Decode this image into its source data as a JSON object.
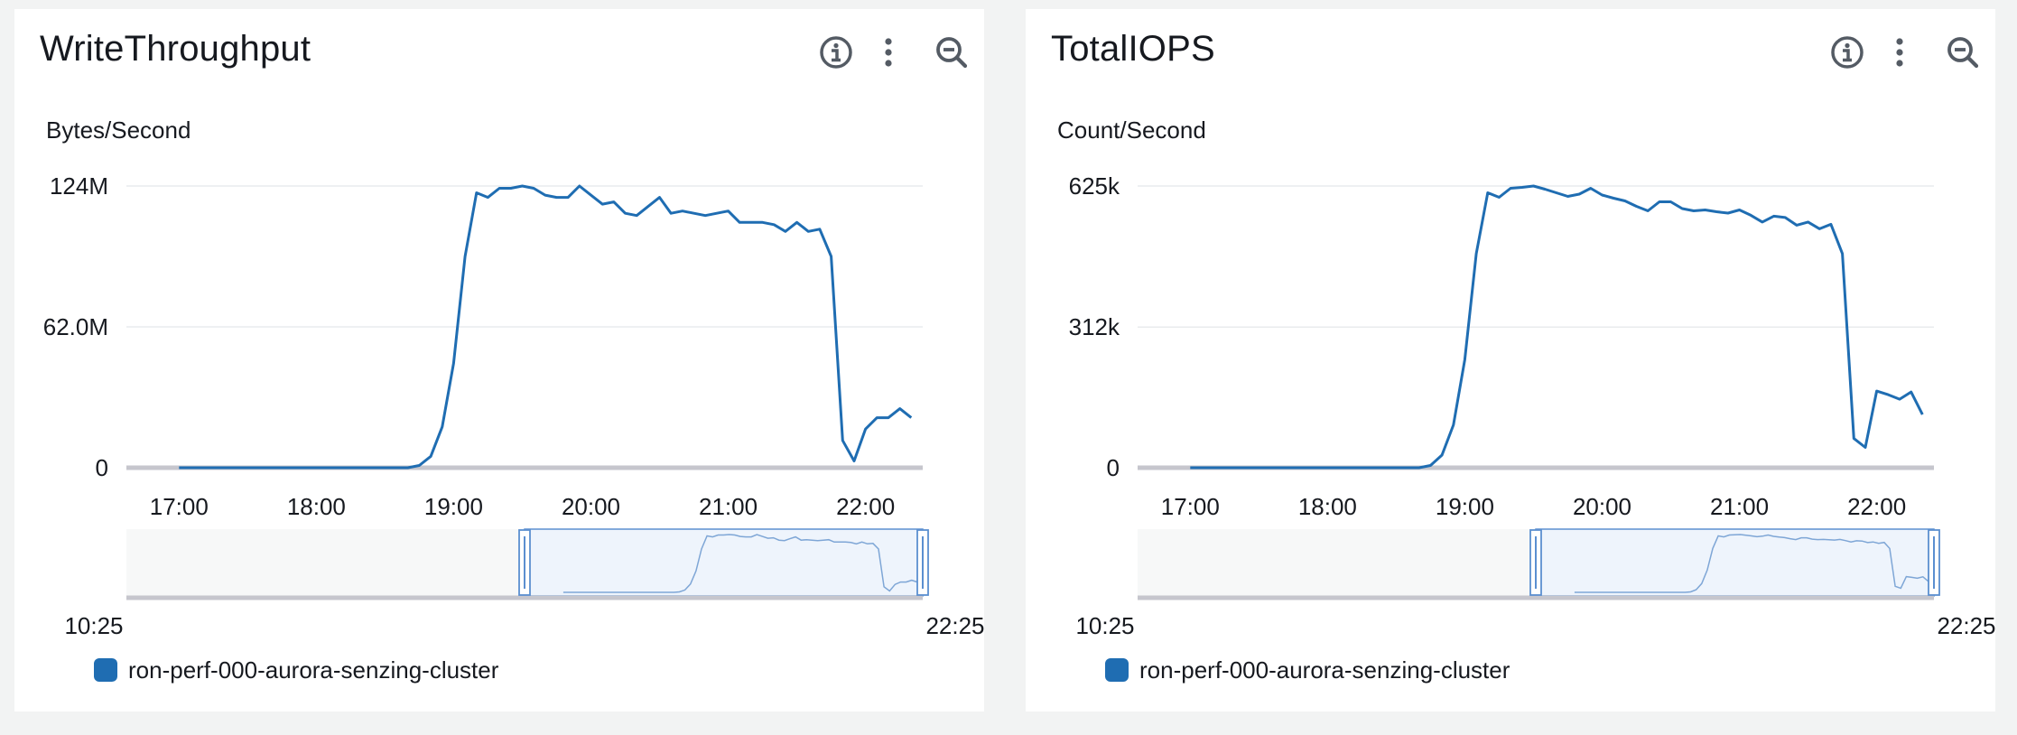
{
  "colors": {
    "page_background": "#f2f3f3",
    "panel_background": "#ffffff",
    "series": "#1f6db2",
    "grid": "#e9ebed",
    "baseline": "#c6c6cd",
    "navigator_fill": "#f7f8f8",
    "navigator_selection": "#eef4fc",
    "navigator_border": "#5b8fd0"
  },
  "icons": {
    "info": "info-circle-icon",
    "menu": "vertical-ellipsis-icon",
    "zoom": "zoom-out-icon"
  },
  "chart_data": [
    {
      "type": "line",
      "title": "WriteThroughput",
      "ylabel": "Bytes/Second",
      "ylim": [
        0,
        124000000
      ],
      "yticks": [
        0,
        62000000,
        124000000
      ],
      "ytick_labels": [
        "0",
        "62.0M",
        "124M"
      ],
      "xlim": [
        "16:37",
        "22:25"
      ],
      "xtick_labels": [
        "17:00",
        "18:00",
        "19:00",
        "20:00",
        "21:00",
        "22:00"
      ],
      "grid": true,
      "legend_position": "bottom-left",
      "navigator": {
        "start_label": "10:25",
        "end_label": "22:25",
        "selection": [
          "16:25",
          "22:25"
        ]
      },
      "series": [
        {
          "name": "ron-perf-000-aurora-senzing-cluster",
          "color": "#1f6db2",
          "x": [
            "17:00",
            "17:05",
            "17:10",
            "17:15",
            "17:20",
            "17:25",
            "17:30",
            "17:35",
            "17:40",
            "17:45",
            "17:50",
            "17:55",
            "18:00",
            "18:05",
            "18:10",
            "18:15",
            "18:20",
            "18:25",
            "18:30",
            "18:35",
            "18:40",
            "18:45",
            "18:50",
            "18:55",
            "19:00",
            "19:05",
            "19:10",
            "19:15",
            "19:20",
            "19:25",
            "19:30",
            "19:35",
            "19:40",
            "19:45",
            "19:50",
            "19:55",
            "20:00",
            "20:05",
            "20:10",
            "20:15",
            "20:20",
            "20:25",
            "20:30",
            "20:35",
            "20:40",
            "20:45",
            "20:50",
            "20:55",
            "21:00",
            "21:05",
            "21:10",
            "21:15",
            "21:20",
            "21:25",
            "21:30",
            "21:35",
            "21:40",
            "21:45",
            "21:50",
            "21:55",
            "22:00",
            "22:05",
            "22:10",
            "22:15",
            "22:20"
          ],
          "values": [
            0,
            0,
            0,
            0,
            0,
            0,
            0,
            0,
            0,
            0,
            0,
            0,
            0,
            0,
            0,
            0,
            0,
            0,
            0,
            0,
            0,
            1000000,
            5000000,
            18000000,
            46000000,
            93000000,
            121000000,
            119000000,
            123000000,
            123000000,
            124000000,
            123000000,
            120000000,
            119000000,
            119000000,
            124000000,
            120000000,
            116000000,
            117000000,
            112000000,
            111000000,
            115000000,
            119000000,
            112000000,
            113000000,
            112000000,
            111000000,
            112000000,
            113000000,
            108000000,
            108000000,
            108000000,
            107000000,
            104000000,
            108000000,
            104000000,
            105000000,
            93000000,
            12000000,
            3000000,
            17000000,
            22000000,
            22000000,
            26000000,
            22000000
          ]
        }
      ]
    },
    {
      "type": "line",
      "title": "TotalIOPS",
      "ylabel": "Count/Second",
      "ylim": [
        0,
        625000
      ],
      "yticks": [
        0,
        312000,
        625000
      ],
      "ytick_labels": [
        "0",
        "312k",
        "625k"
      ],
      "xlim": [
        "16:37",
        "22:25"
      ],
      "xtick_labels": [
        "17:00",
        "18:00",
        "19:00",
        "20:00",
        "21:00",
        "22:00"
      ],
      "grid": true,
      "legend_position": "bottom-left",
      "navigator": {
        "start_label": "10:25",
        "end_label": "22:25",
        "selection": [
          "16:25",
          "22:25"
        ]
      },
      "series": [
        {
          "name": "ron-perf-000-aurora-senzing-cluster",
          "color": "#1f6db2",
          "x": [
            "17:00",
            "17:05",
            "17:10",
            "17:15",
            "17:20",
            "17:25",
            "17:30",
            "17:35",
            "17:40",
            "17:45",
            "17:50",
            "17:55",
            "18:00",
            "18:05",
            "18:10",
            "18:15",
            "18:20",
            "18:25",
            "18:30",
            "18:35",
            "18:40",
            "18:45",
            "18:50",
            "18:55",
            "19:00",
            "19:05",
            "19:10",
            "19:15",
            "19:20",
            "19:25",
            "19:30",
            "19:35",
            "19:40",
            "19:45",
            "19:50",
            "19:55",
            "20:00",
            "20:05",
            "20:10",
            "20:15",
            "20:20",
            "20:25",
            "20:30",
            "20:35",
            "20:40",
            "20:45",
            "20:50",
            "20:55",
            "21:00",
            "21:05",
            "21:10",
            "21:15",
            "21:20",
            "21:25",
            "21:30",
            "21:35",
            "21:40",
            "21:45",
            "21:50",
            "21:55",
            "22:00",
            "22:05",
            "22:10",
            "22:15",
            "22:20"
          ],
          "values": [
            0,
            0,
            0,
            0,
            0,
            0,
            0,
            0,
            0,
            0,
            0,
            0,
            0,
            0,
            0,
            0,
            0,
            0,
            0,
            0,
            0,
            5000,
            28000,
            95000,
            240000,
            475000,
            610000,
            600000,
            620000,
            622000,
            625000,
            618000,
            610000,
            602000,
            607000,
            620000,
            605000,
            598000,
            592000,
            580000,
            570000,
            590000,
            590000,
            575000,
            570000,
            572000,
            568000,
            565000,
            572000,
            560000,
            545000,
            558000,
            555000,
            538000,
            545000,
            530000,
            540000,
            475000,
            65000,
            45000,
            170000,
            162000,
            152000,
            168000,
            118000
          ]
        }
      ]
    }
  ]
}
